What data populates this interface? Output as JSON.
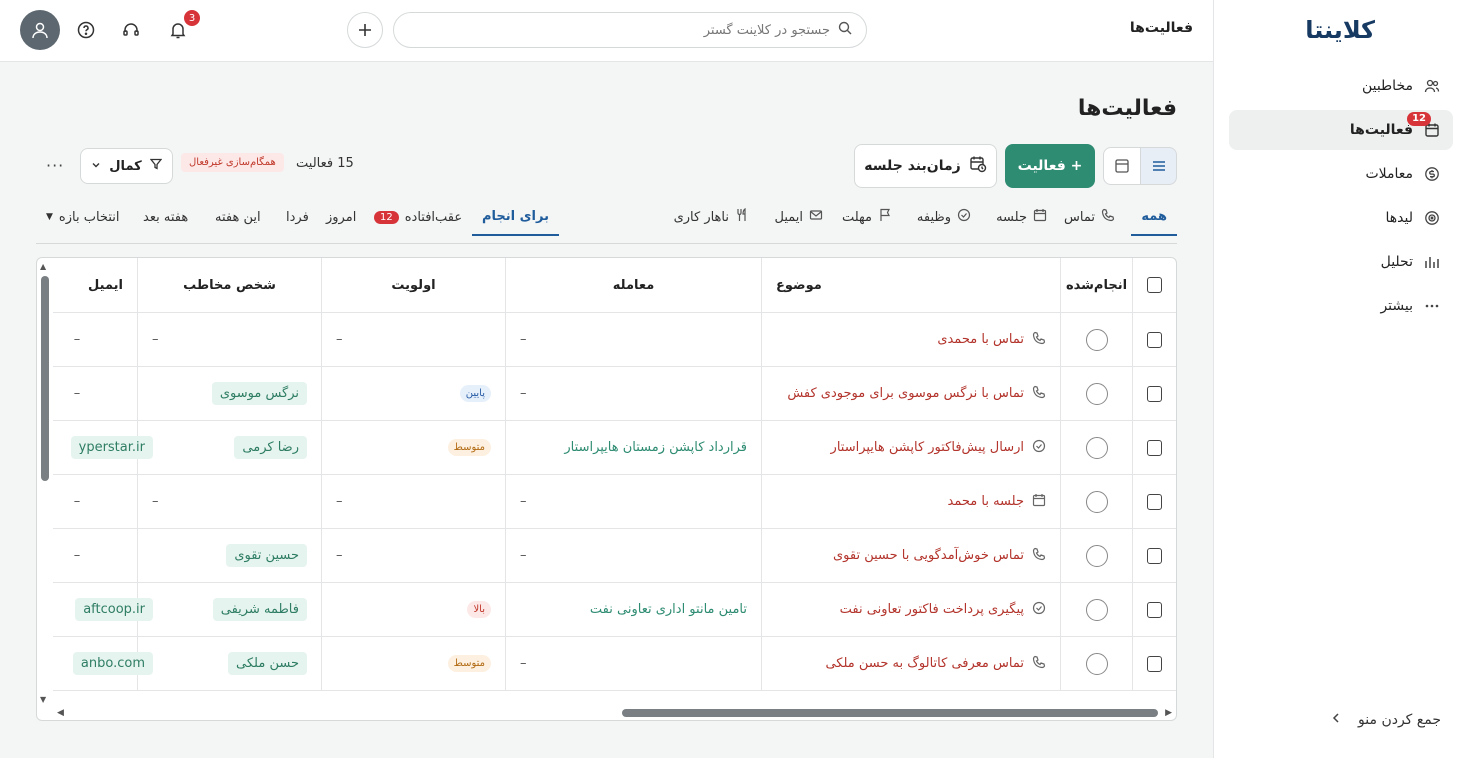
{
  "app": {
    "logo_text": "کلاینتا"
  },
  "sidebar": {
    "items": [
      {
        "label": "مخاطبین",
        "icon": "contacts-icon"
      },
      {
        "label": "فعالیت‌ها",
        "icon": "activities-icon",
        "badge": "12"
      },
      {
        "label": "معاملات",
        "icon": "deals-icon"
      },
      {
        "label": "لیدها",
        "icon": "leads-icon"
      },
      {
        "label": "تحلیل",
        "icon": "analytics-icon"
      },
      {
        "label": "بیشتر",
        "icon": "more-icon"
      }
    ],
    "collapse_label": "جمع کردن منو"
  },
  "topbar": {
    "title": "فعالیت‌ها",
    "search_placeholder": "جستجو در کلاینت گستر",
    "notification_count": "3"
  },
  "main": {
    "title": "فعالیت‌ها",
    "add_button": "+ فعالیت",
    "schedule_button": "زمان‌بند جلسه",
    "count_label": "15 فعالیت",
    "sync_badge": "همگام‌سازی غیرفعال",
    "filter_label": "کمال"
  },
  "tabs": {
    "types": [
      "همه",
      "تماس",
      "جلسه",
      "وظیفه",
      "مهلت",
      "ایمیل",
      "ناهار کاری"
    ],
    "status": [
      {
        "label": "برای انجام"
      },
      {
        "label": "عقب‌افتاده",
        "badge": "12"
      },
      {
        "label": "امروز"
      },
      {
        "label": "فردا"
      },
      {
        "label": "این هفته"
      },
      {
        "label": "هفته بعد"
      },
      {
        "label": "انتخاب بازه"
      }
    ]
  },
  "table": {
    "headers": {
      "done": "انجام‌شده",
      "subject": "موضوع",
      "deal": "معامله",
      "priority": "اولویت",
      "person": "شخص مخاطب",
      "email": "ایمیل"
    },
    "rows": [
      {
        "type": "call",
        "subject": "تماس با محمدی",
        "deal": "–",
        "priority": "–",
        "priority_level": "",
        "person": "–",
        "email": "–"
      },
      {
        "type": "call",
        "subject": "تماس با نرگس موسوی برای موجودی کفش",
        "deal": "–",
        "priority": "پایین",
        "priority_level": "low",
        "person": "نرگس موسوی",
        "email": "–"
      },
      {
        "type": "task",
        "subject": "ارسال پیش‌فاکتور کاپشن هایپراستار",
        "deal": "قرارداد کاپشن زمستان هایپراستار",
        "priority": "متوسط",
        "priority_level": "mid",
        "person": "رضا کرمی",
        "email": "yperstar.ir"
      },
      {
        "type": "meeting",
        "subject": "جلسه با محمد",
        "deal": "–",
        "priority": "–",
        "priority_level": "",
        "person": "–",
        "email": "–"
      },
      {
        "type": "call",
        "subject": "تماس خوش‌آمدگویی با حسین تقوی",
        "deal": "–",
        "priority": "–",
        "priority_level": "",
        "person": "حسین تقوی",
        "email": "–"
      },
      {
        "type": "task",
        "subject": "پیگیری پرداخت فاکتور تعاونی نفت",
        "deal": "تامین مانتو اداری تعاونی نفت",
        "priority": "بالا",
        "priority_level": "high",
        "person": "فاطمه شریفی",
        "email": "aftcoop.ir"
      },
      {
        "type": "call",
        "subject": "تماس معرفی کاتالوگ به حسن ملکی",
        "deal": "–",
        "priority": "متوسط",
        "priority_level": "mid",
        "person": "حسن ملکی",
        "email": "anbo.com"
      }
    ]
  },
  "colors": {
    "accent": "#2e8c72",
    "brand": "#173a63",
    "danger": "#d7343a",
    "link_blue": "#1f5c9c"
  }
}
